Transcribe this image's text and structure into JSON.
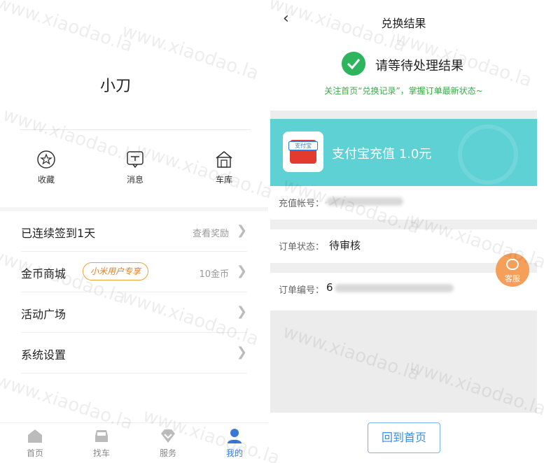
{
  "left": {
    "username": "小刀",
    "shortcuts": [
      {
        "label": "收藏",
        "icon": "star-icon"
      },
      {
        "label": "消息",
        "icon": "message-icon"
      },
      {
        "label": "车库",
        "icon": "garage-icon"
      }
    ],
    "menu": [
      {
        "label": "已连续签到1天",
        "right": "查看奖励"
      },
      {
        "label": "金币商城",
        "badge": "小米用户专享",
        "right": "10金币"
      },
      {
        "label": "活动广场",
        "right": ""
      },
      {
        "label": "系统设置",
        "right": ""
      }
    ],
    "tabs": [
      {
        "label": "首页",
        "icon": "home-icon",
        "active": false
      },
      {
        "label": "找车",
        "icon": "car-icon",
        "active": false
      },
      {
        "label": "服务",
        "icon": "diamond-icon",
        "active": false
      },
      {
        "label": "我的",
        "icon": "user-icon",
        "active": true
      }
    ]
  },
  "right": {
    "nav_title": "兑换结果",
    "status_text": "请等待处理结果",
    "hint": "关注首页“兑换记录”，掌握订单最新状态~",
    "card": {
      "logo_tag": "支付宝",
      "title": "支付宝充值  1.0元"
    },
    "info": [
      {
        "label": "充值帐号：",
        "value": ""
      },
      {
        "label": "订单状态：",
        "value": "待审核"
      },
      {
        "label": "订单编号：",
        "value": "6"
      }
    ],
    "cs_label": "客服",
    "home_button": "回到首页"
  },
  "watermark": "www.xiaodao.la",
  "colors": {
    "success_green": "#2db55d",
    "hint_green": "#3caa4a",
    "card_teal": "#5ed1d5",
    "active_blue": "#3a78d8",
    "badge_orange": "#f0a23a",
    "cs_orange": "#f5a05a",
    "button_blue": "#3b8ede"
  }
}
